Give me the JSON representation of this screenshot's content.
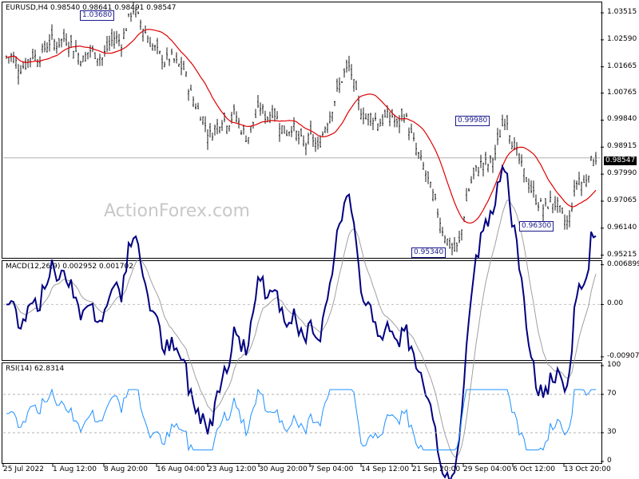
{
  "chart_data": [
    {
      "type": "candlestick",
      "title": "EURUSD,H4",
      "ohlc_readout": [
        "0.98540",
        "0.98641",
        "0.98491",
        "0.98547"
      ],
      "current_price": "0.98547",
      "y_ticks": [
        "1.03515",
        "1.02590",
        "1.01665",
        "1.00765",
        "0.99840",
        "0.98915",
        "0.97990",
        "0.97065",
        "0.96140",
        "0.95215"
      ],
      "ylim": [
        0.9515,
        1.039
      ],
      "ma_color": "#e00000",
      "bar_color": "#1a1a1a",
      "annotations": [
        "1.03680",
        "0.99980",
        "0.96300",
        "0.95340"
      ],
      "watermark": "ActionForex.com"
    },
    {
      "type": "line",
      "title": "MACD(12,26,9) 0.002952 0.001702",
      "y_ticks": [
        "0.006899",
        "0.00",
        "-0.009076"
      ],
      "ylim": [
        -0.0095,
        0.0074
      ],
      "series_colors": [
        "#000080",
        "#a0a0a0"
      ]
    },
    {
      "type": "line",
      "title": "RSI(14) 62.8314",
      "y_ticks": [
        "100",
        "70",
        "30",
        "0"
      ],
      "levels": [
        70,
        30
      ],
      "ylim": [
        0,
        100
      ],
      "series_colors": [
        "#1e90ff"
      ]
    }
  ],
  "x_axis": {
    "tick_labels": [
      "25 Jul 2022",
      "1 Aug 12:00",
      "8 Aug 20:00",
      "16 Aug 04:00",
      "23 Aug 12:00",
      "30 Aug 20:00",
      "7 Sep 04:00",
      "14 Sep 12:00",
      "21 Sep 20:00",
      "29 Sep 04:00",
      "6 Oct 12:00",
      "13 Oct 20:00"
    ]
  },
  "price_path": [
    [
      0,
      1.02
    ],
    [
      8,
      1.0205
    ],
    [
      16,
      1.016
    ],
    [
      24,
      1.0175
    ],
    [
      32,
      1.021
    ],
    [
      40,
      1.0195
    ],
    [
      48,
      1.023
    ],
    [
      56,
      1.026
    ],
    [
      64,
      1.0245
    ],
    [
      72,
      1.0265
    ],
    [
      80,
      1.025
    ],
    [
      88,
      1.0215
    ],
    [
      96,
      1.019
    ],
    [
      104,
      1.0225
    ],
    [
      112,
      1.021
    ],
    [
      120,
      1.0195
    ],
    [
      128,
      1.024
    ],
    [
      136,
      1.027
    ],
    [
      144,
      1.025
    ],
    [
      152,
      1.032
    ],
    [
      158,
      1.0368
    ],
    [
      166,
      1.033
    ],
    [
      174,
      1.0285
    ],
    [
      182,
      1.024
    ],
    [
      190,
      1.0215
    ],
    [
      198,
      1.0185
    ],
    [
      206,
      1.02
    ],
    [
      214,
      1.0175
    ],
    [
      222,
      1.016
    ],
    [
      230,
      1.008
    ],
    [
      238,
      1.003
    ],
    [
      246,
      0.999
    ],
    [
      254,
      0.993
    ],
    [
      262,
      0.996
    ],
    [
      270,
      0.999
    ],
    [
      278,
      0.9975
    ],
    [
      286,
      1.001
    ],
    [
      294,
      0.9955
    ],
    [
      302,
      0.992
    ],
    [
      310,
      0.9985
    ],
    [
      318,
      1.003
    ],
    [
      326,
      0.999
    ],
    [
      334,
      1.002
    ],
    [
      342,
      0.997
    ],
    [
      350,
      0.994
    ],
    [
      358,
      0.9965
    ],
    [
      366,
      0.992
    ],
    [
      374,
      0.99
    ],
    [
      382,
      0.993
    ],
    [
      390,
      0.9885
    ],
    [
      398,
      0.9955
    ],
    [
      406,
      1.001
    ],
    [
      414,
      1.008
    ],
    [
      422,
      1.014
    ],
    [
      430,
      1.017
    ],
    [
      436,
      1.009
    ],
    [
      442,
      1.003
    ],
    [
      450,
      0.999
    ],
    [
      458,
      1.0
    ],
    [
      466,
      0.9975
    ],
    [
      474,
      0.999
    ],
    [
      482,
      1.0005
    ],
    [
      490,
      0.996
    ],
    [
      498,
      1.001
    ],
    [
      506,
      0.994
    ],
    [
      514,
      0.9875
    ],
    [
      522,
      0.9825
    ],
    [
      530,
      0.976
    ],
    [
      538,
      0.969
    ],
    [
      546,
      0.961
    ],
    [
      554,
      0.956
    ],
    [
      562,
      0.9534
    ],
    [
      568,
      0.957
    ],
    [
      574,
      0.968
    ],
    [
      580,
      0.976
    ],
    [
      588,
      0.981
    ],
    [
      596,
      0.984
    ],
    [
      604,
      0.983
    ],
    [
      612,
      0.987
    ],
    [
      620,
      0.996
    ],
    [
      626,
      0.9998
    ],
    [
      632,
      0.992
    ],
    [
      638,
      0.988
    ],
    [
      644,
      0.983
    ],
    [
      650,
      0.979
    ],
    [
      658,
      0.974
    ],
    [
      666,
      0.97
    ],
    [
      674,
      0.968
    ],
    [
      682,
      0.971
    ],
    [
      690,
      0.969
    ],
    [
      698,
      0.964
    ],
    [
      704,
      0.963
    ],
    [
      710,
      0.973
    ],
    [
      716,
      0.979
    ],
    [
      722,
      0.976
    ],
    [
      728,
      0.98
    ],
    [
      734,
      0.986
    ],
    [
      740,
      0.9855
    ]
  ]
}
